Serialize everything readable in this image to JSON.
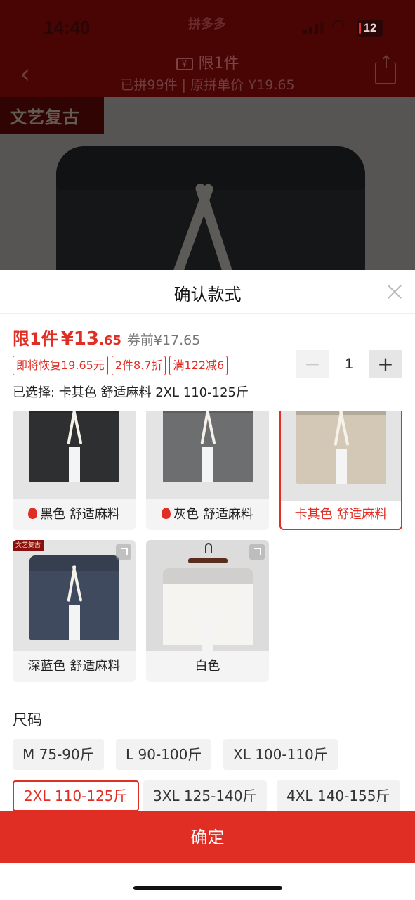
{
  "status": {
    "time": "14:40",
    "app": "拼多多",
    "battery": "12"
  },
  "header": {
    "title": "限1件",
    "sold": "已拼99件",
    "orig_price": "原拼单价 ¥19.65"
  },
  "shop_logo": "文艺复古",
  "sheet": {
    "title": "确认款式",
    "price_limit": "限1件",
    "price_int": "¥13",
    "price_dec": ".65",
    "price_before": "券前¥17.65",
    "promos": [
      "即将恢复19.65元",
      "2件8.7折",
      "满122减6"
    ],
    "quantity": "1",
    "selected": "已选择: 卡其色 舒适麻料 2XL 110-125斤"
  },
  "colors": [
    {
      "label": "黑色 舒适麻料",
      "hot": true,
      "color": "#2e2f31"
    },
    {
      "label": "灰色 舒适麻料",
      "hot": true,
      "color": "#6d6e70"
    },
    {
      "label": "卡其色 舒适麻料",
      "hot": false,
      "color": "#d3c8b5",
      "selected": true
    },
    {
      "label": "深蓝色 舒适麻料",
      "hot": false,
      "color": "#3f4a5e"
    },
    {
      "label": "白色",
      "hot": false,
      "color": "#f3f2ef"
    }
  ],
  "size": {
    "title": "尺码",
    "options": [
      "M 75-90斤",
      "L 90-100斤",
      "XL 100-110斤",
      "2XL 110-125斤",
      "3XL 125-140斤",
      "4XL 140-155斤"
    ],
    "selected_index": 3
  },
  "confirm_label": "确定",
  "accent": "#e02e24"
}
